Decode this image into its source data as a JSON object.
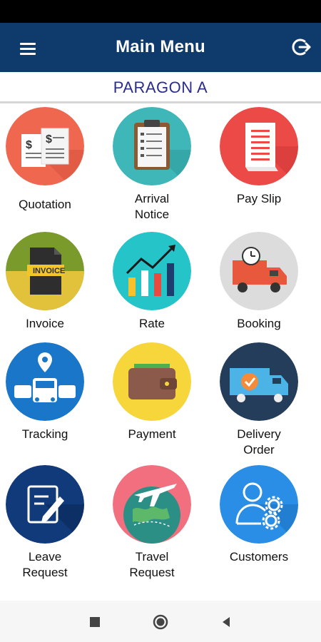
{
  "app_bar": {
    "title": "Main Menu",
    "menu_icon": "hamburger-menu-icon",
    "logout_icon": "logout-icon"
  },
  "company": {
    "name": "PARAGON A"
  },
  "colors": {
    "app_bar": "#0e3a6c",
    "company_text": "#2b2d8c"
  },
  "tiles": [
    {
      "label": "Quotation",
      "icon": "quotation-icon"
    },
    {
      "label": "Arrival\nNotice",
      "icon": "clipboard-checklist-icon"
    },
    {
      "label": "Pay Slip",
      "icon": "receipt-icon"
    },
    {
      "label": "Invoice",
      "icon": "invoice-icon"
    },
    {
      "label": "Rate",
      "icon": "bar-chart-trend-icon"
    },
    {
      "label": "Booking",
      "icon": "delivery-truck-clock-icon"
    },
    {
      "label": "Tracking",
      "icon": "truck-location-pin-icon"
    },
    {
      "label": "Payment",
      "icon": "wallet-icon"
    },
    {
      "label": "Delivery\nOrder",
      "icon": "delivery-truck-check-icon"
    },
    {
      "label": "Leave\nRequest",
      "icon": "document-pen-icon"
    },
    {
      "label": "Travel\nRequest",
      "icon": "globe-airplane-icon"
    },
    {
      "label": "Customers",
      "icon": "user-gears-icon"
    }
  ],
  "nav": {
    "recents_icon": "square-recents-icon",
    "home_icon": "circle-home-icon",
    "back_icon": "triangle-back-icon"
  }
}
